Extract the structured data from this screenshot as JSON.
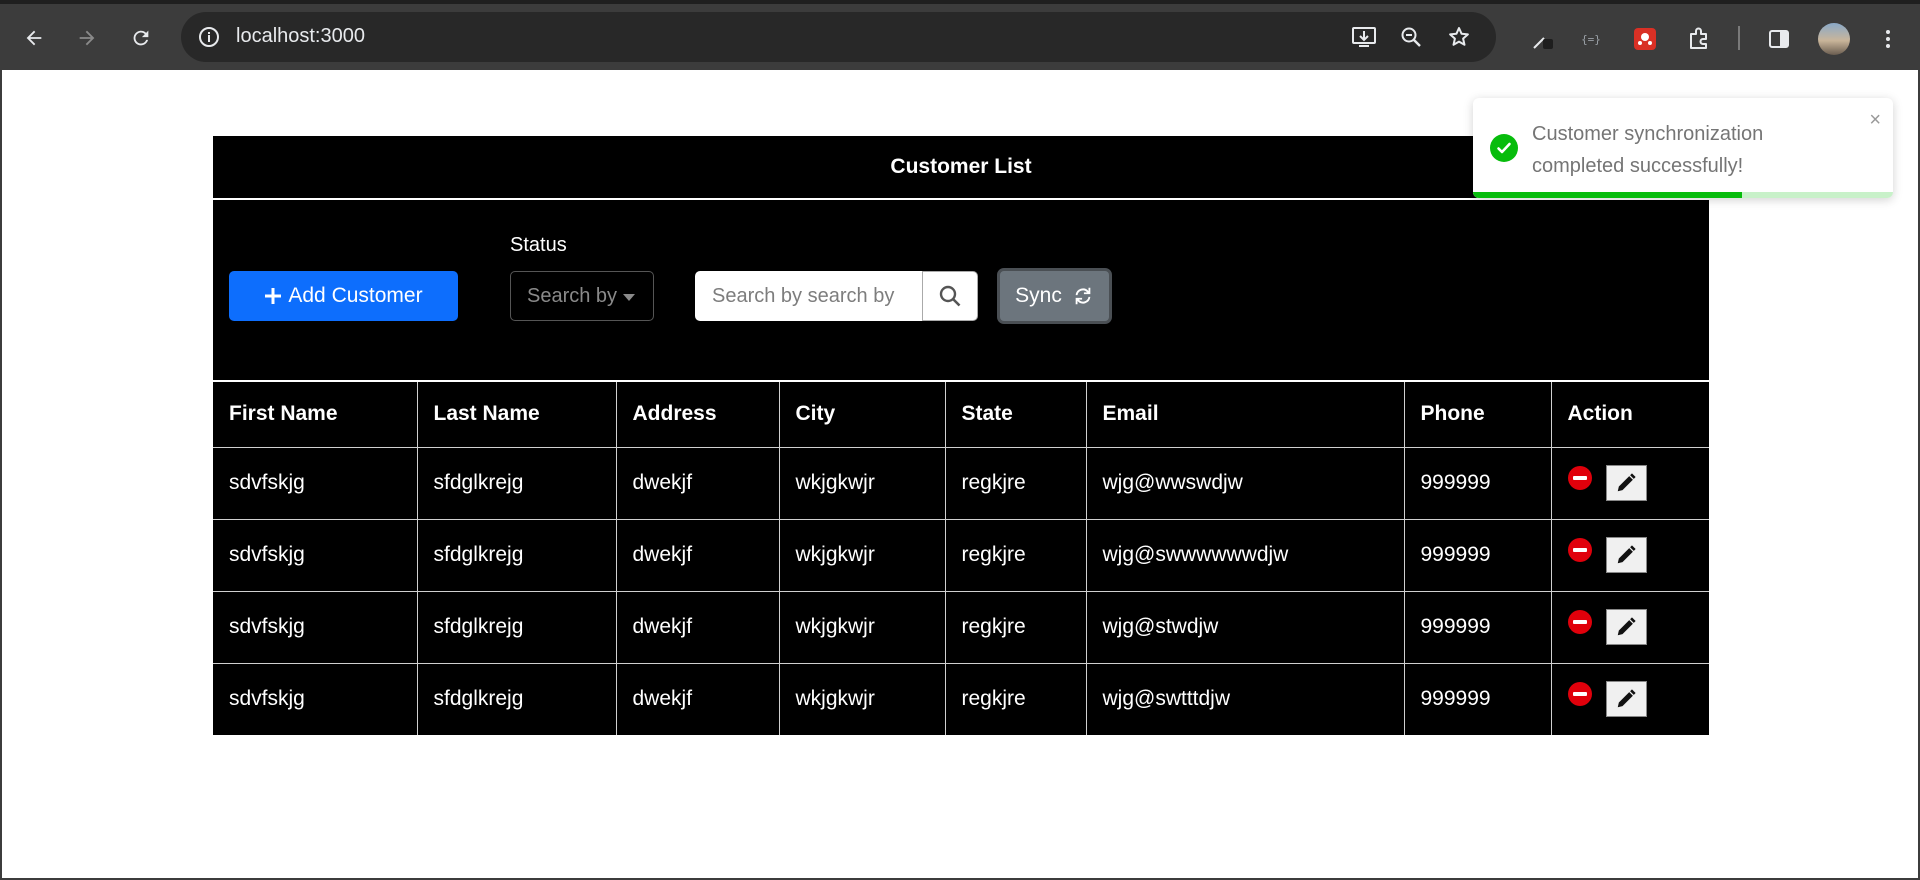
{
  "browser": {
    "url": "localhost:3000"
  },
  "app": {
    "title": "Customer List",
    "add_button_label": "Add Customer",
    "status_label": "Status",
    "status_select_value": "Search by",
    "search_placeholder": "Search by search by",
    "sync_label": "Sync"
  },
  "table": {
    "columns": [
      "First Name",
      "Last Name",
      "Address",
      "City",
      "State",
      "Email",
      "Phone",
      "Action"
    ],
    "rows": [
      [
        "sdvfskjg",
        "sfdglkrejg",
        "dwekjf",
        "wkjgkwjr",
        "regkjre",
        "wjg@wwswdjw",
        "999999"
      ],
      [
        "sdvfskjg",
        "sfdglkrejg",
        "dwekjf",
        "wkjgkwjr",
        "regkjre",
        "wjg@swwwwwwdjw",
        "999999"
      ],
      [
        "sdvfskjg",
        "sfdglkrejg",
        "dwekjf",
        "wkjgkwjr",
        "regkjre",
        "wjg@stwdjw",
        "999999"
      ],
      [
        "sdvfskjg",
        "sfdglkrejg",
        "dwekjf",
        "wkjgkwjr",
        "regkjre",
        "wjg@swtttdjw",
        "999999"
      ]
    ]
  },
  "toast": {
    "message": "Customer synchronization completed successfully!",
    "close_symbol": "×",
    "progress": 0.64
  },
  "colors": {
    "accent": "#0d6efd",
    "success": "#07bc0c",
    "danger": "#e0000b",
    "sync": "#6c757d"
  }
}
